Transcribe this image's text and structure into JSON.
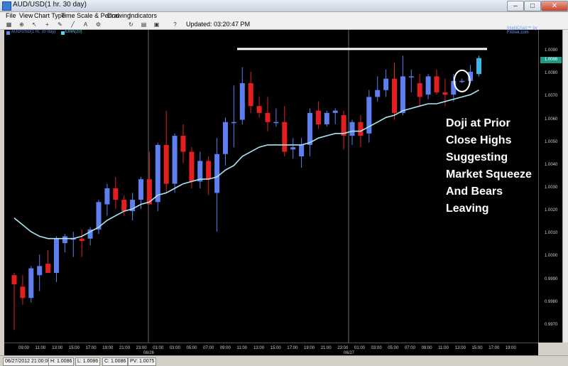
{
  "window": {
    "title": "AUD/USD(1 hr. 30 day)",
    "controls": [
      "–",
      "□",
      "✕"
    ]
  },
  "menu": {
    "items": [
      "File",
      "View",
      "Chart Type",
      "Time Scale & Period",
      "Drawing",
      "Indicators"
    ]
  },
  "toolbar": {
    "icons": [
      "chart-type-icon",
      "zoom-icon",
      "cursor-icon",
      "crosshair-icon",
      "draw-icon",
      "trendline-icon",
      "text-icon",
      "settings-icon",
      "refresh-icon",
      "print-icon",
      "save-icon",
      "help-icon"
    ],
    "updated_text": "Updated: 03:20:47 PM"
  },
  "chart": {
    "legend_symbol": "AUD/USD(1 hr, 30 day)",
    "legend_ema": "EMA(20)",
    "branding": "IntelliChart™ by FXtrek.com",
    "annotation": [
      "Doji at Prior",
      "Close Highs",
      "Suggesting",
      "Market Squeeze",
      "And Bears",
      "Leaving"
    ],
    "price_axis_labels": [
      "1.0090",
      "1.0080",
      "1.0070",
      "1.0060",
      "1.0050",
      "1.0040",
      "1.0030",
      "1.0020",
      "1.0010",
      "1.0000",
      "0.9990",
      "0.9980",
      "0.9970"
    ],
    "current_price_badge": "1.0086",
    "time_labels": [
      "09:00",
      "11:00",
      "13:00",
      "15:00",
      "17:00",
      "19:00",
      "21:00",
      "23:00",
      "01:00",
      "03:00",
      "05:00",
      "07:00",
      "09:00",
      "11:00",
      "13:00",
      "15:00",
      "17:00",
      "19:00",
      "21:00",
      "23:00",
      "01:00",
      "03:00",
      "05:00",
      "07:00",
      "09:00",
      "11:00",
      "13:00",
      "15:00",
      "17:00",
      "19:00"
    ],
    "date_labels": [
      "06/26",
      "06/27"
    ],
    "colors": {
      "bull": "#5f7ff0",
      "bear": "#e41f1f",
      "ema": "#a8e6f5",
      "last_bull": "#3bb6e8",
      "resistance": "#ffffff"
    }
  },
  "chart_data": {
    "type": "candlestick",
    "title": "AUD/USD(1 hr. 30 day)",
    "ylim": [
      0.9965,
      1.0095
    ],
    "series": [
      {
        "name": "AUD/USD(1 hr, 30 day)",
        "ohlc": [
          [
            0.9992,
            0.9993,
            0.9968,
            0.9988
          ],
          [
            0.9987,
            0.9992,
            0.9979,
            0.9982
          ],
          [
            0.9982,
            0.9996,
            0.998,
            0.9995
          ],
          [
            0.9992,
            1.0001,
            0.9985,
            0.9996
          ],
          [
            0.9997,
            1.0003,
            0.9994,
            0.9993
          ],
          [
            0.9993,
            1.0009,
            0.9989,
            1.0008
          ],
          [
            1.0006,
            1.001,
            1.0002,
            1.0009
          ],
          [
            1.0008,
            1.0011,
            1.0,
            1.0008
          ],
          [
            1.0008,
            1.0012,
            1.0,
            1.0007
          ],
          [
            1.0008,
            1.0013,
            1.0005,
            1.0012
          ],
          [
            1.0012,
            1.0025,
            1.001,
            1.0024
          ],
          [
            1.0023,
            1.0032,
            1.0018,
            1.003
          ],
          [
            1.003,
            1.0035,
            1.0021,
            1.0025
          ],
          [
            1.0025,
            1.0027,
            1.0018,
            1.002
          ],
          [
            1.002,
            1.0028,
            1.0016,
            1.0025
          ],
          [
            1.0025,
            1.0035,
            1.0021,
            1.0034
          ],
          [
            1.0034,
            1.0046,
            1.0023,
            1.0023
          ],
          [
            1.0024,
            1.005,
            1.002,
            1.0049
          ],
          [
            1.0049,
            1.0064,
            1.0028,
            1.0032
          ],
          [
            1.0032,
            1.0054,
            1.0028,
            1.0053
          ],
          [
            1.0053,
            1.0058,
            1.0041,
            1.0046
          ],
          [
            1.0046,
            1.0048,
            1.003,
            1.0033
          ],
          [
            1.0033,
            1.0046,
            1.003,
            1.0042
          ],
          [
            1.0042,
            1.0044,
            1.0027,
            1.0034
          ],
          [
            1.0028,
            1.0052,
            1.0011,
            1.0045
          ],
          [
            1.0045,
            1.0061,
            1.004,
            1.0059
          ],
          [
            1.0059,
            1.0075,
            1.0048,
            1.0059
          ],
          [
            1.006,
            1.0083,
            1.0058,
            1.0076
          ],
          [
            1.0076,
            1.0081,
            1.0063,
            1.0066
          ],
          [
            1.0066,
            1.007,
            1.0061,
            1.0063
          ],
          [
            1.0063,
            1.007,
            1.0055,
            1.0059
          ],
          [
            1.0059,
            1.0065,
            1.0057,
            1.0059
          ],
          [
            1.0059,
            1.0066,
            1.0044,
            1.0046
          ],
          [
            1.0047,
            1.0052,
            1.0043,
            1.0048
          ],
          [
            1.0044,
            1.0052,
            1.0039,
            1.0049
          ],
          [
            1.0049,
            1.0065,
            1.0044,
            1.0063
          ],
          [
            1.0064,
            1.0068,
            1.0056,
            1.0058
          ],
          [
            1.0058,
            1.0064,
            1.0057,
            1.0063
          ],
          [
            1.0063,
            1.0065,
            1.0058,
            1.0064
          ],
          [
            1.0062,
            1.0064,
            1.0047,
            1.0053
          ],
          [
            1.0053,
            1.006,
            1.0049,
            1.0059
          ],
          [
            1.0059,
            1.0062,
            1.0048,
            1.0053
          ],
          [
            1.0054,
            1.0073,
            1.005,
            1.007
          ],
          [
            1.007,
            1.0079,
            1.0068,
            1.0073
          ],
          [
            1.0073,
            1.0082,
            1.007,
            1.0078
          ],
          [
            1.0078,
            1.0085,
            1.006,
            1.0063
          ],
          [
            1.0063,
            1.0088,
            1.0062,
            1.0079
          ],
          [
            1.0079,
            1.0082,
            1.0072,
            1.0079
          ],
          [
            1.0076,
            1.008,
            1.0066,
            1.007
          ],
          [
            1.0071,
            1.008,
            1.0069,
            1.0079
          ],
          [
            1.0079,
            1.0082,
            1.0071,
            1.0072
          ],
          [
            1.0072,
            1.0078,
            1.0066,
            1.0071
          ],
          [
            1.0071,
            1.008,
            1.0068,
            1.0077
          ],
          [
            1.0077,
            1.0078,
            1.0076,
            1.0077
          ],
          [
            1.0077,
            1.0084,
            1.0076,
            1.0081
          ],
          [
            1.008,
            1.0088,
            1.0079,
            1.0087
          ]
        ]
      },
      {
        "name": "EMA(20)",
        "values": [
          1.0017,
          1.0014,
          1.0011,
          1.0009,
          1.0008,
          1.0008,
          1.0008,
          1.0008,
          1.0009,
          1.0011,
          1.0013,
          1.0016,
          1.0018,
          1.002,
          1.0021,
          1.0023,
          1.0024,
          1.0027,
          1.0028,
          1.003,
          1.0032,
          1.0033,
          1.0034,
          1.0034,
          1.0035,
          1.0038,
          1.004,
          1.0044,
          1.0046,
          1.0048,
          1.0049,
          1.0049,
          1.0049,
          1.0049,
          1.0049,
          1.005,
          1.0052,
          1.0053,
          1.0054,
          1.0054,
          1.0055,
          1.0055,
          1.0057,
          1.0059,
          1.0061,
          1.0062,
          1.0064,
          1.0065,
          1.0066,
          1.0067,
          1.0067,
          1.0068,
          1.0069,
          1.007,
          1.0071,
          1.0073
        ]
      }
    ],
    "resistance_level": 1.0091
  },
  "status": {
    "datetime": "06/27/2012 21:00:00",
    "high": "H: 1.0086",
    "low": "L: 1.0086",
    "close": "C: 1.0086",
    "pv": "PV: 1.0075"
  }
}
